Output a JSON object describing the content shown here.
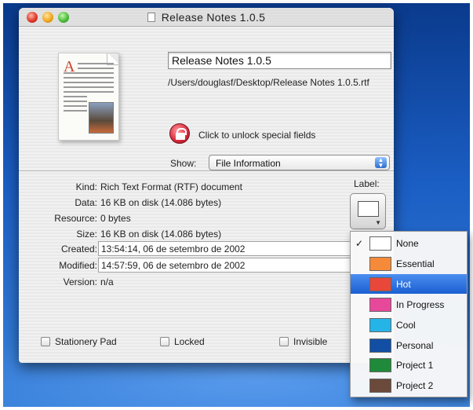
{
  "window": {
    "title": "Release Notes 1.0.5"
  },
  "file": {
    "name": "Release Notes 1.0.5",
    "path": "/Users/douglasf/Desktop/Release Notes 1.0.5.rtf"
  },
  "lock": {
    "label": "Click to unlock special fields"
  },
  "show": {
    "label": "Show:",
    "value": "File Information"
  },
  "info": {
    "kind": {
      "label": "Kind:",
      "value": "Rich Text Format (RTF) document"
    },
    "data": {
      "label": "Data:",
      "value": "16 KB on disk (14.086 bytes)"
    },
    "resource": {
      "label": "Resource:",
      "value": "0 bytes"
    },
    "size": {
      "label": "Size:",
      "value": "16 KB on disk (14.086 bytes)"
    },
    "created": {
      "label": "Created:",
      "value": "13:54:14, 06 de setembro de 2002"
    },
    "modified": {
      "label": "Modified:",
      "value": "14:57:59, 06 de setembro de 2002"
    },
    "version": {
      "label": "Version:",
      "value": "n/a"
    }
  },
  "label_section": {
    "heading": "Label:",
    "current_color": "#ffffff"
  },
  "checkboxes": {
    "stationery": "Stationery Pad",
    "locked": "Locked",
    "invisible": "Invisible"
  },
  "label_menu": {
    "checked": "None",
    "highlighted": "Hot",
    "items": [
      {
        "name": "None",
        "color": "#ffffff"
      },
      {
        "name": "Essential",
        "color": "#f58a3a"
      },
      {
        "name": "Hot",
        "color": "#e8473a"
      },
      {
        "name": "In Progress",
        "color": "#e8489a"
      },
      {
        "name": "Cool",
        "color": "#25b4e8"
      },
      {
        "name": "Personal",
        "color": "#124fa4"
      },
      {
        "name": "Project 1",
        "color": "#1f8a3a"
      },
      {
        "name": "Project 2",
        "color": "#6b4a3c"
      }
    ]
  }
}
